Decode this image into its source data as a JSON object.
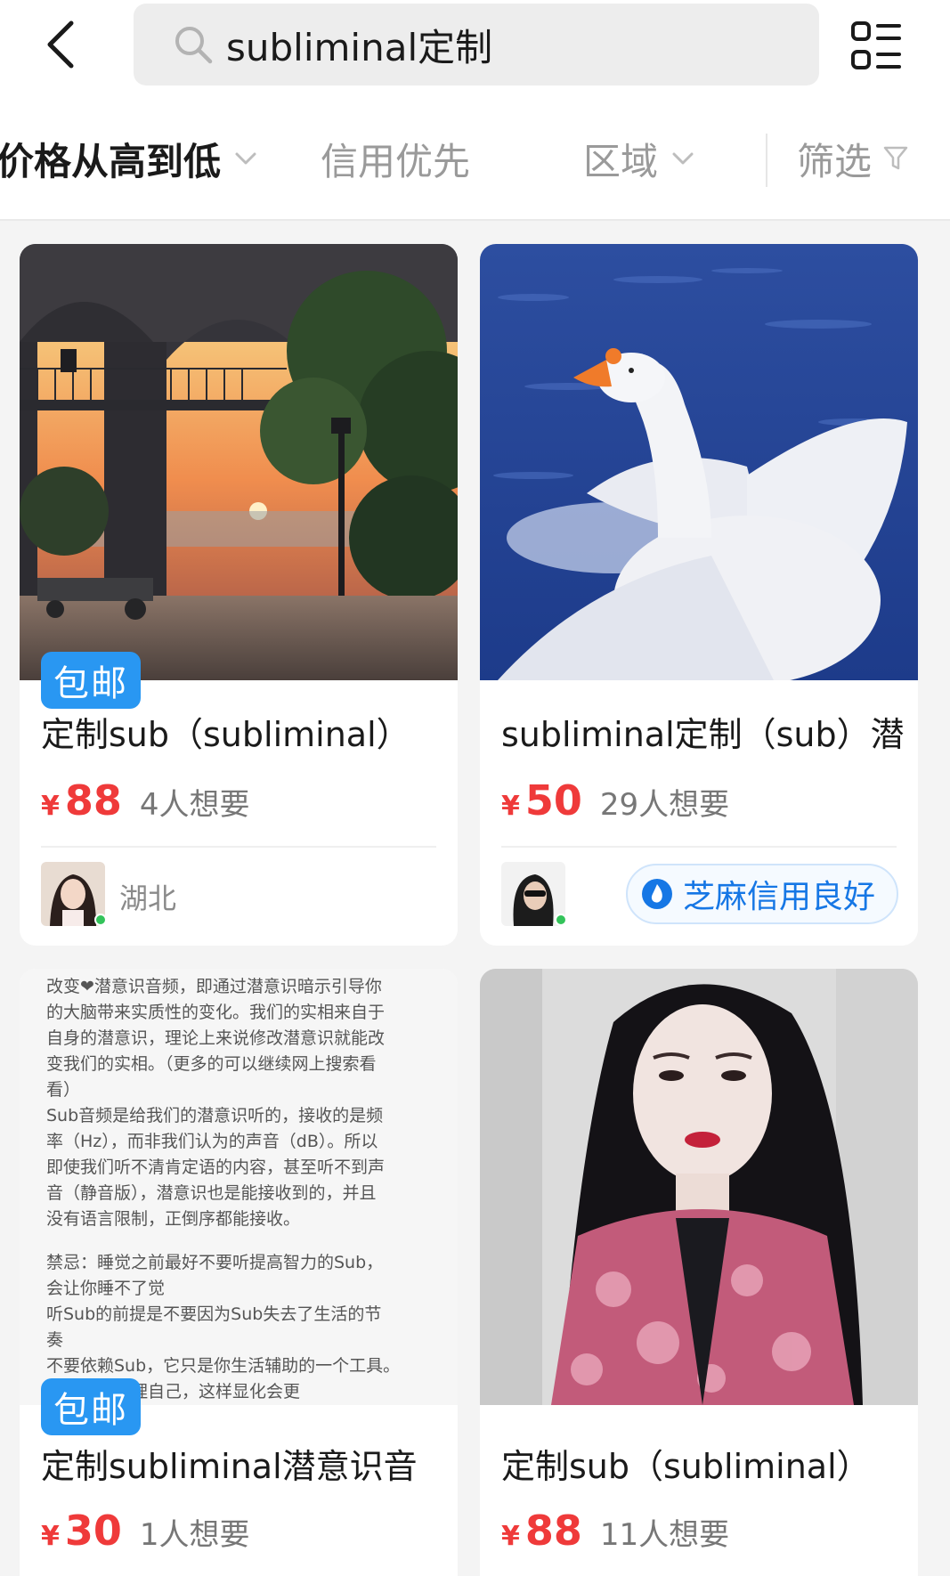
{
  "search": {
    "query": "subliminal定制"
  },
  "sort_bar": {
    "price_label": "价格从高到低",
    "credit_label": "信用优先",
    "region_label": "区域",
    "filter_label": "筛选"
  },
  "products": [
    {
      "badge": "包邮",
      "title": "定制sub（subliminal）",
      "currency": "¥",
      "price": "88",
      "wants": "4人想要",
      "seller_region": "湖北"
    },
    {
      "title": "subliminal定制（sub）潜",
      "currency": "¥",
      "price": "50",
      "wants": "29人想要",
      "credit_label": "芝麻信用良好"
    },
    {
      "badge": "包邮",
      "title": "定制subliminal潜意识音",
      "currency": "¥",
      "price": "30",
      "wants": "1人想要",
      "image_text": [
        "改变❤潜意识音频，即通过潜意识暗示引导你",
        "的大脑带来实质性的变化。我们的实相来自于",
        "自身的潜意识，理论上来说修改潜意识就能改",
        "变我们的实相。（更多的可以继续网上搜索看",
        "看）",
        "Sub音频是给我们的潜意识听的，接收的是频",
        "率（Hz），而非我们认为的声音（dB）。所以",
        "即使我们听不清肯定语的内容，甚至听不到声",
        "音（静音版），潜意识也是能接收到的，并且",
        "没有语言限制，正倒序都能接收。",
        "",
        "禁忌：睡觉之前最好不要听提高智力的Sub，",
        "会让你睡不了觉",
        "听Sub的前提是不要因为Sub失去了生活的节",
        "奏",
        "不要依赖Sub，它只是你生活辅助的一个工具。",
        "提下最好清理自己，这样显化会更"
      ]
    },
    {
      "title": "定制sub（subliminal）",
      "currency": "¥",
      "price": "88",
      "wants": "11人想要"
    }
  ],
  "colors": {
    "price_red": "#ef3a3a",
    "badge_blue": "#2997f2",
    "credit_blue": "#1677e5",
    "online_green": "#33c35a"
  },
  "icons": [
    "back-arrow-icon",
    "search-icon",
    "grid-list-icon",
    "chevron-down-icon",
    "funnel-icon",
    "sesame-credit-icon"
  ]
}
